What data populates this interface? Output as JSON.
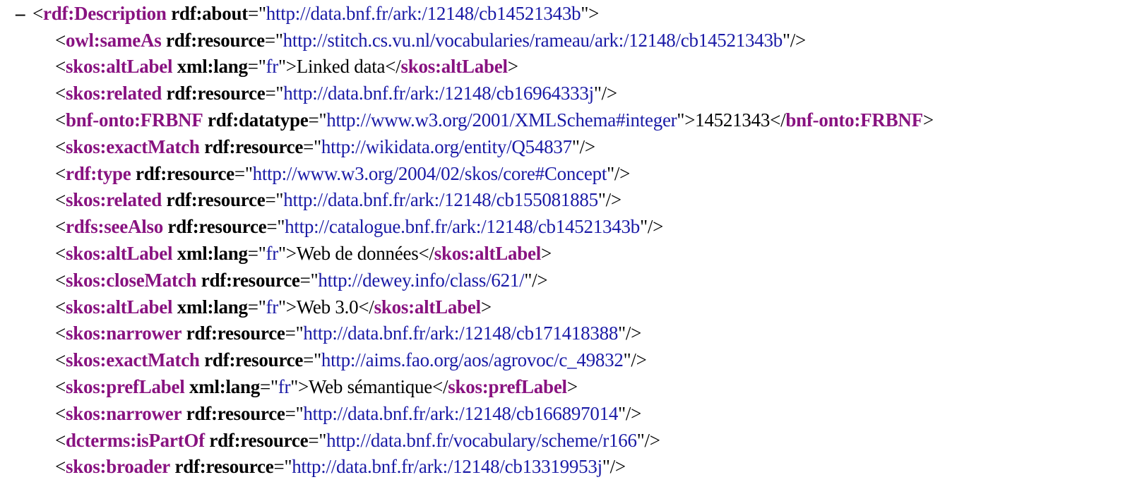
{
  "collapse_symbol": "–",
  "root": {
    "tag": "rdf:Description",
    "attr": "rdf:about",
    "value": "http://data.bnf.fr/ark:/12148/cb14521343b"
  },
  "children": [
    {
      "tag": "owl:sameAs",
      "attr": "rdf:resource",
      "value": "http://stitch.cs.vu.nl/vocabularies/rameau/ark:/12148/cb14521343b"
    },
    {
      "tag": "skos:altLabel",
      "attr": "xml:lang",
      "value": "fr",
      "text": "Linked data"
    },
    {
      "tag": "skos:related",
      "attr": "rdf:resource",
      "value": "http://data.bnf.fr/ark:/12148/cb16964333j"
    },
    {
      "tag": "bnf-onto:FRBNF",
      "attr": "rdf:datatype",
      "value": "http://www.w3.org/2001/XMLSchema#integer",
      "text": "14521343"
    },
    {
      "tag": "skos:exactMatch",
      "attr": "rdf:resource",
      "value": "http://wikidata.org/entity/Q54837"
    },
    {
      "tag": "rdf:type",
      "attr": "rdf:resource",
      "value": "http://www.w3.org/2004/02/skos/core#Concept"
    },
    {
      "tag": "skos:related",
      "attr": "rdf:resource",
      "value": "http://data.bnf.fr/ark:/12148/cb155081885"
    },
    {
      "tag": "rdfs:seeAlso",
      "attr": "rdf:resource",
      "value": "http://catalogue.bnf.fr/ark:/12148/cb14521343b"
    },
    {
      "tag": "skos:altLabel",
      "attr": "xml:lang",
      "value": "fr",
      "text": "Web de données"
    },
    {
      "tag": "skos:closeMatch",
      "attr": "rdf:resource",
      "value": "http://dewey.info/class/621/"
    },
    {
      "tag": "skos:altLabel",
      "attr": "xml:lang",
      "value": "fr",
      "text": "Web 3.0"
    },
    {
      "tag": "skos:narrower",
      "attr": "rdf:resource",
      "value": "http://data.bnf.fr/ark:/12148/cb171418388"
    },
    {
      "tag": "skos:exactMatch",
      "attr": "rdf:resource",
      "value": "http://aims.fao.org/aos/agrovoc/c_49832"
    },
    {
      "tag": "skos:prefLabel",
      "attr": "xml:lang",
      "value": "fr",
      "text": "Web sémantique"
    },
    {
      "tag": "skos:narrower",
      "attr": "rdf:resource",
      "value": "http://data.bnf.fr/ark:/12148/cb166897014"
    },
    {
      "tag": "dcterms:isPartOf",
      "attr": "rdf:resource",
      "value": "http://data.bnf.fr/vocabulary/scheme/r166"
    },
    {
      "tag": "skos:broader",
      "attr": "rdf:resource",
      "value": "http://data.bnf.fr/ark:/12148/cb13319953j"
    }
  ],
  "colors": {
    "tag": "#881280",
    "attribute": "#000000",
    "value": "#1a1aa6",
    "text": "#000000",
    "background": "#ffffff"
  }
}
